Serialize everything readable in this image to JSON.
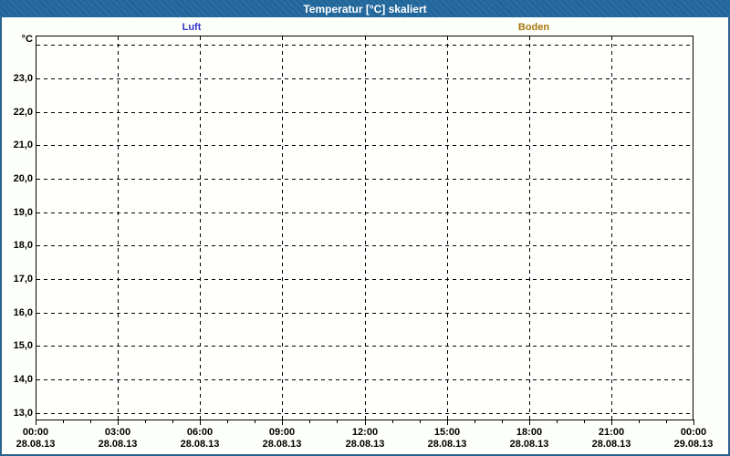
{
  "window": {
    "title": "Temperatur [°C] skaliert"
  },
  "colors": {
    "titlebar_bg": "#21669b",
    "titlebar_text": "#ffffff",
    "frame_border": "#2b628d",
    "page_bg": "#fdfffa",
    "plot_bg": "#fffffd",
    "grid": "#000000",
    "axis_text": "#000000",
    "luft": "#3333cc",
    "boden": "#a5760d"
  },
  "legend": {
    "items": [
      {
        "label": "Luft",
        "color": "#3333cc"
      },
      {
        "label": "Boden",
        "color": "#a5760d"
      }
    ]
  },
  "chart_data": {
    "type": "line",
    "title": "Temperatur [°C] skaliert",
    "xlabel": "",
    "ylabel": "°C",
    "ylim": [
      12.77,
      24.28
    ],
    "xlim_hours": [
      0,
      24
    ],
    "grid": "dashed",
    "legend_position": "top",
    "y_ticks": [
      {
        "value": 24.0,
        "label": ""
      },
      {
        "value": 23.0,
        "label": "23,0"
      },
      {
        "value": 22.0,
        "label": "22,0"
      },
      {
        "value": 21.0,
        "label": "21,0"
      },
      {
        "value": 20.0,
        "label": "20,0"
      },
      {
        "value": 19.0,
        "label": "19,0"
      },
      {
        "value": 18.0,
        "label": "18,0"
      },
      {
        "value": 17.0,
        "label": "17,0"
      },
      {
        "value": 16.0,
        "label": "16,0"
      },
      {
        "value": 15.0,
        "label": "15,0"
      },
      {
        "value": 14.0,
        "label": "14,0"
      },
      {
        "value": 13.0,
        "label": "13,0"
      }
    ],
    "x_major_ticks": [
      {
        "hour": 0,
        "time": "00:00",
        "date": "28.08.13"
      },
      {
        "hour": 3,
        "time": "03:00",
        "date": "28.08.13"
      },
      {
        "hour": 6,
        "time": "06:00",
        "date": "28.08.13"
      },
      {
        "hour": 9,
        "time": "09:00",
        "date": "28.08.13"
      },
      {
        "hour": 12,
        "time": "12:00",
        "date": "28.08.13"
      },
      {
        "hour": 15,
        "time": "15:00",
        "date": "28.08.13"
      },
      {
        "hour": 18,
        "time": "18:00",
        "date": "28.08.13"
      },
      {
        "hour": 21,
        "time": "21:00",
        "date": "28.08.13"
      },
      {
        "hour": 24,
        "time": "00:00",
        "date": "29.08.13"
      }
    ],
    "x_minor_tick_interval_hours": 1,
    "series": [
      {
        "name": "Luft",
        "color": "#3333cc",
        "values": []
      },
      {
        "name": "Boden",
        "color": "#a5760d",
        "values": []
      }
    ]
  }
}
